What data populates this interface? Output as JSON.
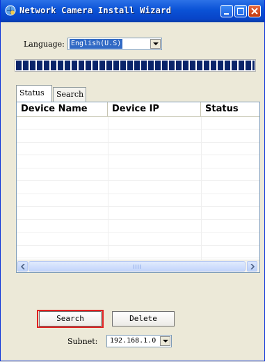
{
  "window": {
    "title": "Network Camera Install Wizard"
  },
  "language": {
    "label": "Language:",
    "selected": "English(U.S)"
  },
  "progress": {
    "fraction": 1.0
  },
  "tabs": [
    {
      "label": "Status"
    },
    {
      "label": "Search"
    }
  ],
  "list": {
    "columns": [
      "Device Name",
      "Device IP",
      "Status"
    ],
    "rows": []
  },
  "buttons": {
    "search": "Search",
    "delete": "Delete"
  },
  "subnet": {
    "label": "Subnet:",
    "selected": "192.168.1.0"
  },
  "colors": {
    "titlebar": "#0A52D6",
    "highlight": "#E02020",
    "progress": "#0A246A"
  }
}
